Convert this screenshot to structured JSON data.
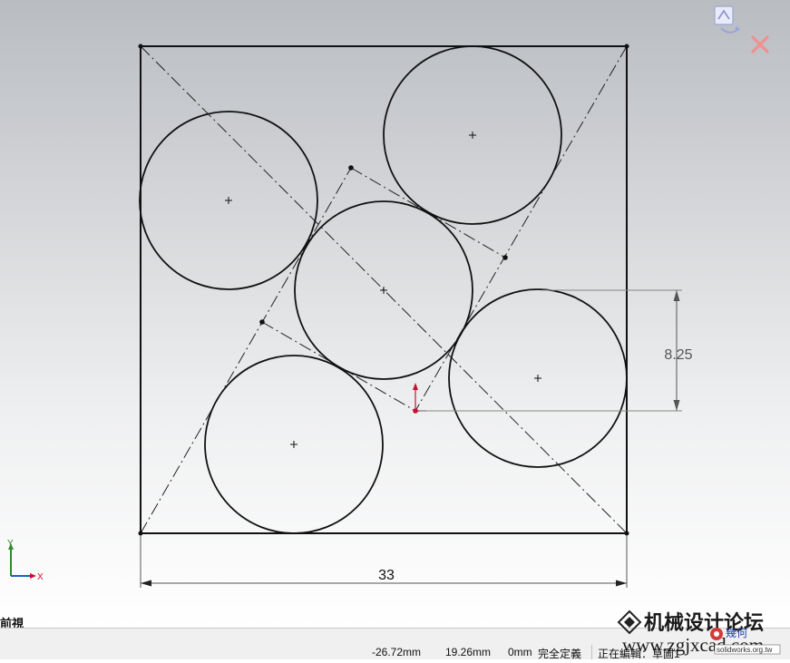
{
  "sketch": {
    "width_dimension": "33",
    "height_dimension": "8.25"
  },
  "view": {
    "label": "前視",
    "triad": {
      "y_axis": "Y",
      "x_axis": "X"
    }
  },
  "confirm_corner": {
    "rebuild_icon": "sketch-exit-icon",
    "cancel_icon": "cancel-x-icon"
  },
  "statusbar": {
    "x_coord": "-26.72mm",
    "y_coord": "19.26mm",
    "z_coord": "0mm",
    "definition_state": "完全定義",
    "editing": "正在編輯：草圖1"
  },
  "watermark": {
    "forum_name": "机械设计论坛",
    "url": "www.zgjxcad.com",
    "small_site": "solidworks.org.tw",
    "badge": "幾何"
  },
  "colors": {
    "origin_red": "#c8102e",
    "triad_green": "#2e8b2e",
    "triad_blue": "#1f5fbf"
  }
}
